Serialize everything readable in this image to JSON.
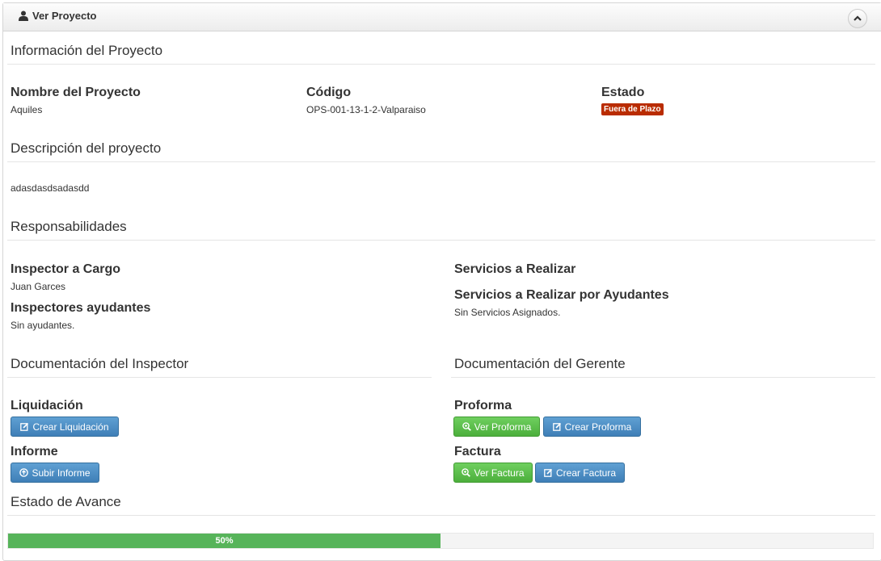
{
  "header": {
    "title": "Ver Proyecto"
  },
  "info": {
    "section_title": "Información del Proyecto",
    "name_label": "Nombre del Proyecto",
    "name_value": "Aquiles",
    "code_label": "Código",
    "code_value": "OPS-001-13-1-2-Valparaiso",
    "status_label": "Estado",
    "status_badge": "Fuera de Plazo",
    "status_color": "#b92c00"
  },
  "description": {
    "section_title": "Descripción del proyecto",
    "text": "adasdasdsadasdd"
  },
  "responsibilities": {
    "section_title": "Responsabilidades",
    "inspector_label": "Inspector a Cargo",
    "inspector_value": "Juan Garces",
    "helpers_label": "Inspectores ayudantes",
    "helpers_value": "Sin ayudantes.",
    "services_label": "Servicios a Realizar",
    "helper_services_label": "Servicios a Realizar por Ayudantes",
    "helper_services_value": "Sin Servicios Asignados."
  },
  "inspector_docs": {
    "section_title": "Documentación del Inspector",
    "liquidacion_label": "Liquidación",
    "crear_liquidacion": "Crear Liquidación",
    "informe_label": "Informe",
    "subir_informe": "Subir Informe"
  },
  "manager_docs": {
    "section_title": "Documentación del Gerente",
    "proforma_label": "Proforma",
    "ver_proforma": "Ver Proforma",
    "crear_proforma": "Crear Proforma",
    "factura_label": "Factura",
    "ver_factura": "Ver Factura",
    "crear_factura": "Crear Factura"
  },
  "progress": {
    "section_title": "Estado de Avance",
    "label": "50%",
    "value": 0.5
  }
}
